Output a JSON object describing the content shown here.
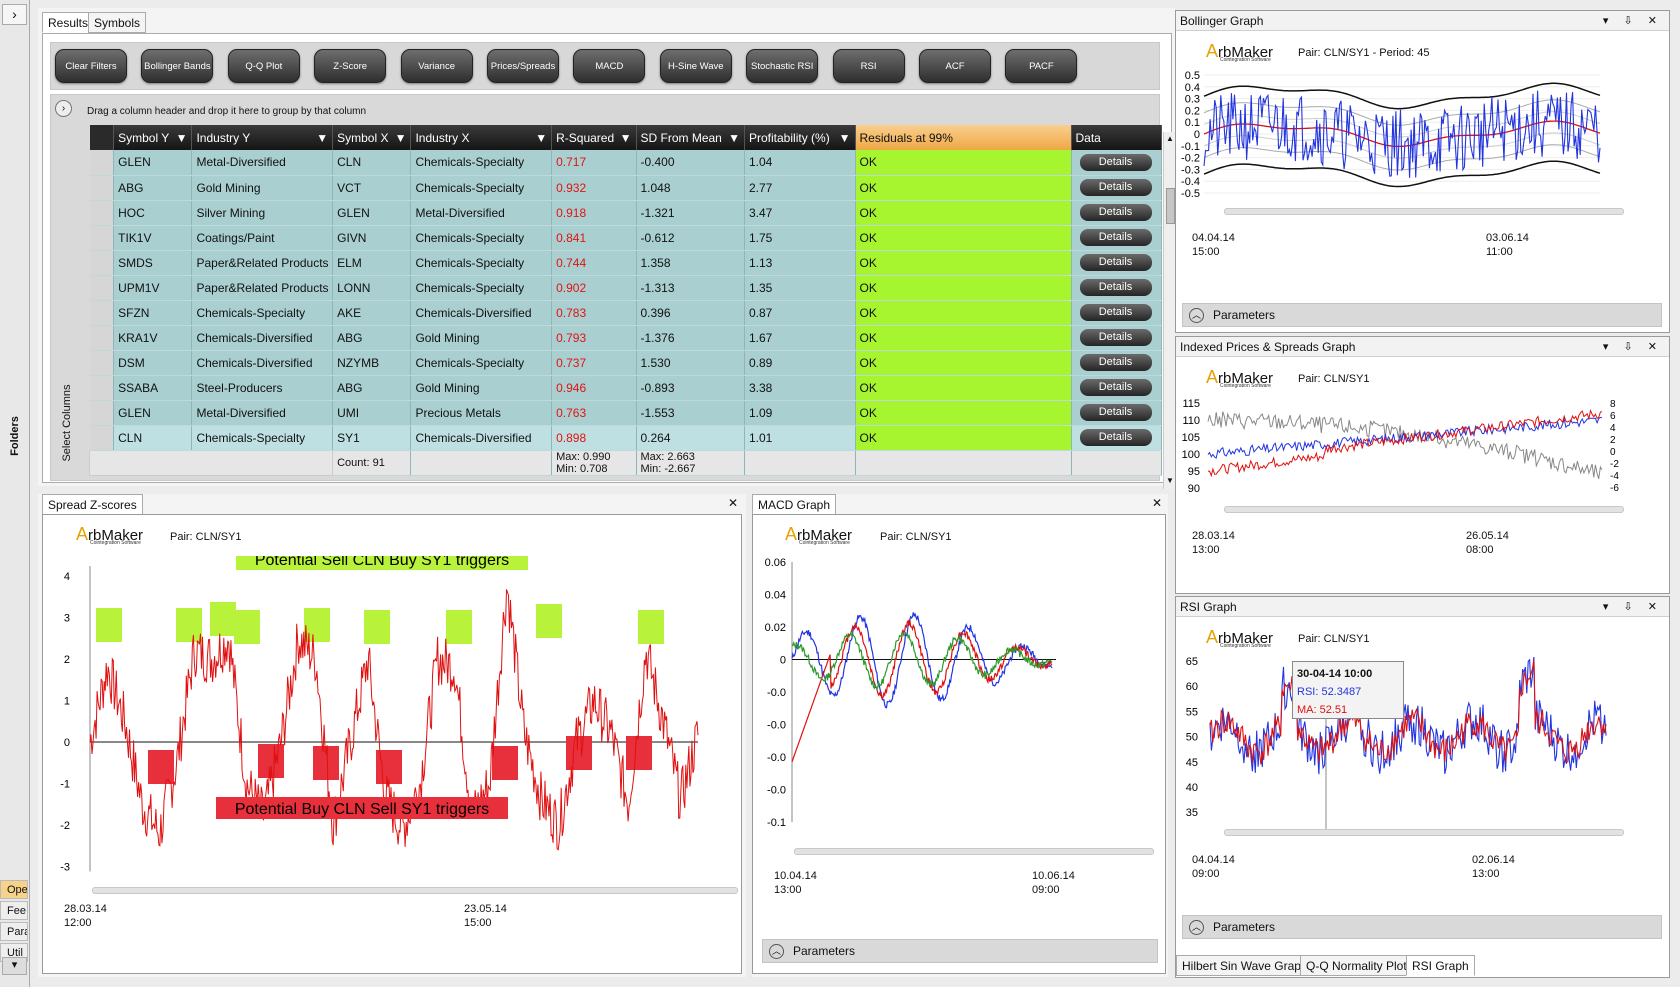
{
  "sidebar": {
    "expand_label": "›",
    "folders_label": "Folders",
    "tabs": [
      "Ope",
      "Fee",
      "Para",
      "Util"
    ],
    "bottom_arrow": "▾"
  },
  "results": {
    "tabs": [
      "Results",
      "Symbols"
    ],
    "toolbar": [
      "Clear Filters",
      "Bollinger Bands",
      "Q-Q Plot",
      "Z-Score",
      "Variance",
      "Prices/Spreads",
      "MACD",
      "H-Sine Wave",
      "Stochastic RSI",
      "RSI",
      "ACF",
      "PACF"
    ],
    "group_hint": "Drag a column header and drop it here to group by that column",
    "select_columns": "Select Columns",
    "columns": [
      "Symbol Y",
      "Industry Y",
      "Symbol X",
      "Industry X",
      "R-Squared",
      "SD From Mean",
      "Profitability (%)",
      "Residuals at 99%",
      "Data"
    ],
    "rows": [
      [
        "GLEN",
        "Metal-Diversified",
        "CLN",
        "Chemicals-Specialty",
        "0.717",
        "-0.400",
        "1.04",
        "OK",
        "Details"
      ],
      [
        "ABG",
        "Gold Mining",
        "VCT",
        "Chemicals-Specialty",
        "0.932",
        "1.048",
        "2.77",
        "OK",
        "Details"
      ],
      [
        "HOC",
        "Silver Mining",
        "GLEN",
        "Metal-Diversified",
        "0.918",
        "-1.321",
        "3.47",
        "OK",
        "Details"
      ],
      [
        "TIK1V",
        "Coatings/Paint",
        "GIVN",
        "Chemicals-Specialty",
        "0.841",
        "-0.612",
        "1.75",
        "OK",
        "Details"
      ],
      [
        "SMDS",
        "Paper&Related Products",
        "ELM",
        "Chemicals-Specialty",
        "0.744",
        "1.358",
        "1.13",
        "OK",
        "Details"
      ],
      [
        "UPM1V",
        "Paper&Related Products",
        "LONN",
        "Chemicals-Specialty",
        "0.902",
        "-1.313",
        "1.35",
        "OK",
        "Details"
      ],
      [
        "SFZN",
        "Chemicals-Specialty",
        "AKE",
        "Chemicals-Diversified",
        "0.783",
        "0.396",
        "0.87",
        "OK",
        "Details"
      ],
      [
        "KRA1V",
        "Chemicals-Diversified",
        "ABG",
        "Gold Mining",
        "0.793",
        "-1.376",
        "1.67",
        "OK",
        "Details"
      ],
      [
        "DSM",
        "Chemicals-Diversified",
        "NZYMB",
        "Chemicals-Specialty",
        "0.737",
        "1.530",
        "0.89",
        "OK",
        "Details"
      ],
      [
        "SSABA",
        "Steel-Producers",
        "ABG",
        "Gold Mining",
        "0.946",
        "-0.893",
        "3.38",
        "OK",
        "Details"
      ],
      [
        "GLEN",
        "Metal-Diversified",
        "UMI",
        "Precious Metals",
        "0.763",
        "-1.553",
        "1.09",
        "OK",
        "Details"
      ],
      [
        "CLN",
        "Chemicals-Specialty",
        "SY1",
        "Chemicals-Diversified",
        "0.898",
        "0.264",
        "1.01",
        "OK",
        "Details"
      ]
    ],
    "footer": {
      "count": "Count: 91",
      "r_max": "Max: 0.990",
      "r_min": "Min: 0.708",
      "sd_max": "Max: 2.663",
      "sd_min": "Min: -2.667"
    }
  },
  "zscore": {
    "tab": "Spread Z-scores",
    "logo": "rbMaker",
    "logo_a": "A",
    "logo_sub": "Cointegration Software",
    "pair": "Pair: CLN/SY1",
    "sell_label": "Potential Sell CLN Buy SY1 triggers",
    "buy_label": "Potential Buy CLN Sell SY1 triggers",
    "yticks": [
      "4",
      "3",
      "2",
      "1",
      "0",
      "-1",
      "-2",
      "-3"
    ],
    "x1": "28.03.14",
    "x1t": "12:00",
    "x2": "23.05.14",
    "x2t": "15:00",
    "colors": {
      "line": "#e01010",
      "sell": "#b8f23a",
      "buy": "#e8303c"
    }
  },
  "macd": {
    "tab": "MACD Graph",
    "pair": "Pair: CLN/SY1",
    "yticks": [
      "0.06",
      "0.04",
      "0.02",
      "0",
      "-0.0",
      "-0.0",
      "-0.0",
      "-0.0",
      "-0.1"
    ],
    "x1": "10.04.14",
    "x1t": "13:00",
    "x2": "10.06.14",
    "x2t": "09:00",
    "params": "Parameters"
  },
  "bollinger": {
    "title": "Bollinger Graph",
    "pair": "Pair: CLN/SY1 - Period: 45",
    "yticks": [
      "0.5",
      "0.4",
      "0.3",
      "0.2",
      "0.1",
      "0",
      "-0.1",
      "-0.2",
      "-0.3",
      "-0.4",
      "-0.5"
    ],
    "x1": "04.04.14",
    "x1t": "15:00",
    "x2": "03.06.14",
    "x2t": "11:00",
    "params": "Parameters"
  },
  "indexed": {
    "title": "Indexed Prices & Spreads Graph",
    "pair": "Pair: CLN/SY1",
    "yticks": [
      "115",
      "110",
      "105",
      "100",
      "95",
      "90"
    ],
    "yticks_r": [
      "8",
      "6",
      "4",
      "2",
      "0",
      "-2",
      "-4",
      "-6"
    ],
    "x1": "28.03.14",
    "x1t": "13:00",
    "x2": "26.05.14",
    "x2t": "08:00"
  },
  "rsi": {
    "title": "RSI Graph",
    "pair": "Pair: CLN/SY1",
    "yticks": [
      "65",
      "60",
      "55",
      "50",
      "45",
      "40",
      "35"
    ],
    "x1": "04.04.14",
    "x1t": "09:00",
    "x2": "02.06.14",
    "x2t": "13:00",
    "params": "Parameters",
    "tooltip": {
      "date": "30-04-14 10:00",
      "rsi": "RSI: 52.3487",
      "ma": "MA: 52.51"
    }
  },
  "bottom_tabs": [
    "Hilbert Sin Wave Graph",
    "Q-Q Normality Plot",
    "RSI Graph"
  ],
  "window_ctrls": "▾ ⇩ ✕"
}
